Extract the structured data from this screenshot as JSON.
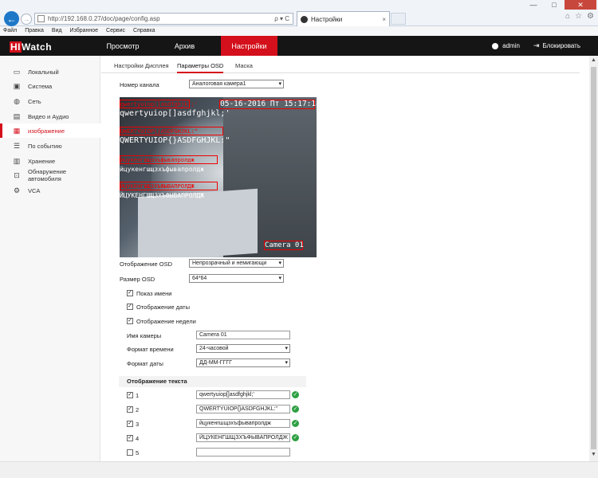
{
  "browser": {
    "url": "http://192.168.0.27/doc/page/config.asp",
    "address_tools": "ρ ▾ C",
    "tab_title": "Настройки",
    "tab_close": "×",
    "win_min": "—",
    "win_max": "□",
    "win_close": "✕",
    "menu": [
      "Файл",
      "Правка",
      "Вид",
      "Избранное",
      "Сервис",
      "Справка"
    ]
  },
  "header": {
    "logo_hi": "HI",
    "logo_rest": "Watch",
    "nav": [
      "Просмотр",
      "Архив",
      "Настройки"
    ],
    "user": "admin",
    "lock": "Блокировать"
  },
  "sidebar": {
    "items": [
      {
        "label": "Локальный",
        "icon": "monitor-icon"
      },
      {
        "label": "Система",
        "icon": "system-icon"
      },
      {
        "label": "Сеть",
        "icon": "network-icon"
      },
      {
        "label": "Видео и Аудио",
        "icon": "video-icon"
      },
      {
        "label": "изображение",
        "icon": "image-icon"
      },
      {
        "label": "По событию",
        "icon": "event-icon"
      },
      {
        "label": "Хранение",
        "icon": "storage-icon"
      },
      {
        "label": "Обнаружение автомобиля",
        "icon": "vehicle-icon"
      },
      {
        "label": "VCA",
        "icon": "vca-icon"
      }
    ],
    "active_index": 4
  },
  "subtabs": [
    "Настройки Дисплея",
    "Параметры OSD",
    "Маска"
  ],
  "channel": {
    "label": "Номер канала",
    "value": "Аналоговая камера1"
  },
  "preview": {
    "datetime": "05-16-2016 Пт 15:17:18",
    "osd_lines": [
      "qwertyuiop[]asdfghjkl;'",
      "QWERTYUIOP{}ASDFGHJKL:\"",
      "йцукенгшщзхъфывапролдж",
      "ЙЦУКЕНГШЩЗХЪФЫВАПРОЛДЖ"
    ],
    "osd_labels": [
      "qwertyuiop[]asdfghjkl;'",
      "QWERTYUIOP{}ASDFGHJKL:\"",
      "йцукенгшщзхъфывапролдж",
      "ЙЦУКЕНГШЩЗХЪФЫВАПРОЛДЖ"
    ],
    "camera_name": "Camera 01"
  },
  "form": {
    "osd_display_label": "Отображение OSD",
    "osd_display_value": "Непрозрачный и немигающи",
    "osd_size_label": "Размер OSD",
    "osd_size_value": "64*64",
    "show_name": "Показ имени",
    "show_date": "Отображение даты",
    "show_week": "Отображение недели",
    "camera_name_label": "Имя камеры",
    "camera_name_value": "Camera 01",
    "time_format_label": "Формат времени",
    "time_format_value": "24-часовой",
    "date_format_label": "Формат даты",
    "date_format_value": "ДД-ММ-ГГГГ",
    "text_section": "Отображение текста",
    "text_rows": [
      {
        "num": "1",
        "checked": true,
        "value": "qwertyuiop[]asdfghjkl;'"
      },
      {
        "num": "2",
        "checked": true,
        "value": "QWERTYUIOP{}ASDFGHJKL:\""
      },
      {
        "num": "3",
        "checked": true,
        "value": "йцукенгшщзхъфывапролдж"
      },
      {
        "num": "4",
        "checked": true,
        "value": "ЙЦУКЕНГШЩЗХЪФЫВАПРОЛДЖ"
      },
      {
        "num": "5",
        "checked": false,
        "value": ""
      }
    ]
  },
  "glyphs": {
    "check": "✓",
    "caret": "▾",
    "back": "←",
    "fwd": "→",
    "ok": "✓",
    "up": "▲",
    "down": "▼"
  }
}
